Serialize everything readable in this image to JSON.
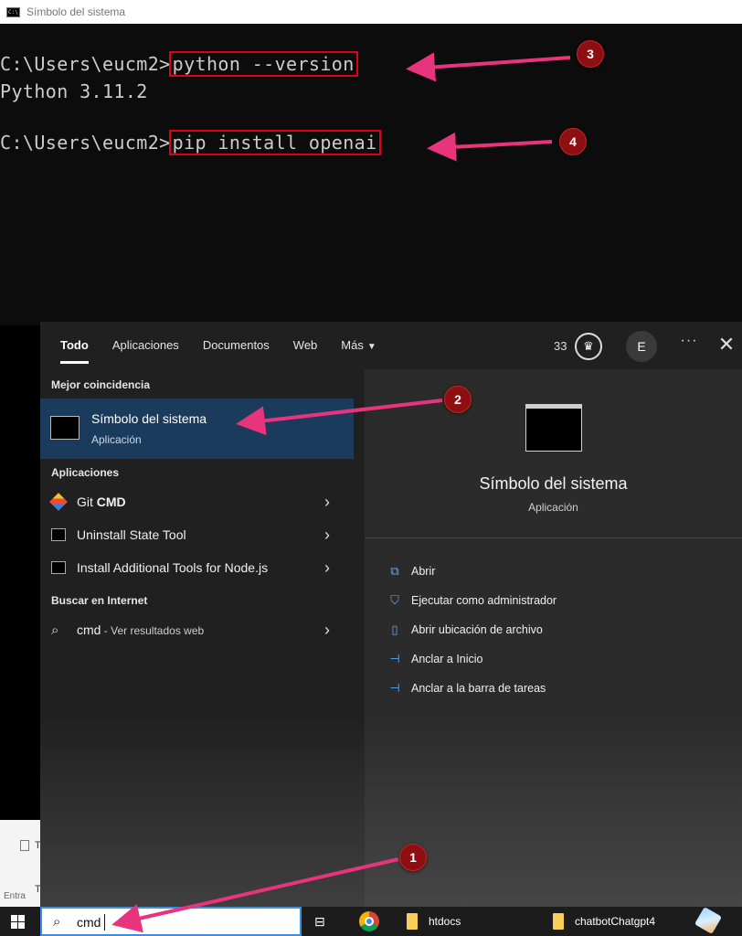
{
  "console": {
    "window_title": "Símbolo del sistema",
    "line1_prompt": "C:\\Users\\eucm2>",
    "line1_command": "python --version",
    "line2_output": "Python 3.11.2",
    "line3_prompt": "C:\\Users\\eucm2>",
    "line3_command": "pip install openai"
  },
  "search_panel": {
    "tabs": [
      "Todo",
      "Aplicaciones",
      "Documentos",
      "Web",
      "Más"
    ],
    "points": "33",
    "avatar_initial": "E",
    "more_label": "···",
    "close_label": "✕",
    "best_match_header": "Mejor coincidencia",
    "best_match": {
      "name": "Símbolo del sistema",
      "type": "Aplicación"
    },
    "apps_header": "Aplicaciones",
    "apps": [
      {
        "prefix": "Git ",
        "bold": "CMD"
      },
      {
        "prefix": "Uninstall State Tool",
        "bold": ""
      },
      {
        "prefix": "Install Additional Tools for Node.js",
        "bold": ""
      }
    ],
    "web_header": "Buscar en Internet",
    "web_result": {
      "query": "cmd",
      "suffix": " - Ver resultados web"
    },
    "preview": {
      "title": "Símbolo del sistema",
      "subtitle": "Aplicación",
      "actions": [
        "Abrir",
        "Ejecutar como administrador",
        "Abrir ubicación de archivo",
        "Anclar a Inicio",
        "Anclar a la barra de tareas"
      ]
    }
  },
  "explorer": {
    "partial_t": "T",
    "partial_t2": "T",
    "partial_entra": "Entra"
  },
  "taskbar": {
    "search_query": "cmd",
    "items": [
      {
        "label": "htdocs"
      },
      {
        "label": "chatbotChatgpt4"
      }
    ]
  },
  "annotations": {
    "badges": [
      "1",
      "2",
      "3",
      "4"
    ],
    "arrow_color": "#e8337d",
    "badge_color": "#8e0f12",
    "highlight_color": "#e0001b"
  }
}
